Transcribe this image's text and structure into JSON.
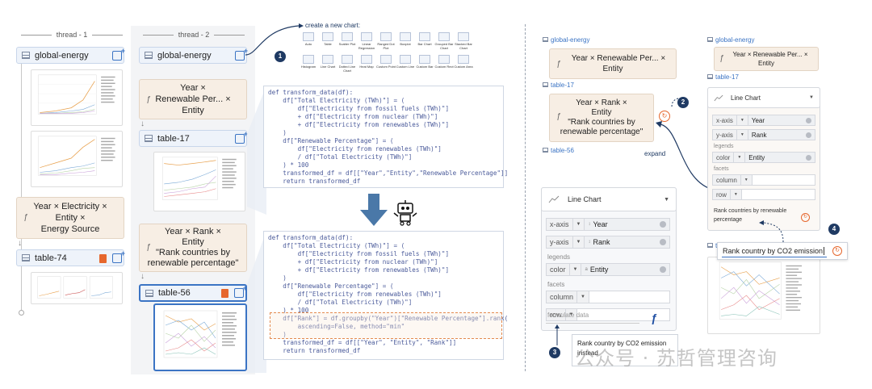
{
  "threads": {
    "thread1_label": "thread - 1",
    "thread2_label": "thread - 2"
  },
  "t1": {
    "global_energy": "global-energy",
    "formula_line1": "Year × Electricity ×",
    "formula_line2": "Entity ×",
    "formula_line3": "Energy Source",
    "table74": "table-74"
  },
  "t2": {
    "global_energy": "global-energy",
    "formula_a1": "Year ×",
    "formula_a2": "Renewable Per... ×",
    "formula_a3": "Entity",
    "table17": "table-17",
    "formula_b1": "Year × Rank ×",
    "formula_b2": "Entity",
    "formula_b3": "\"Rank countries by",
    "formula_b4": "renewable percentage\"",
    "table56": "table-56"
  },
  "new_chart": {
    "title": "create a new chart:",
    "types": [
      "Auto",
      "Table",
      "Scatter Plot",
      "Linear Regression",
      "Ranged Dot Plot",
      "Boxplot",
      "Bar Chart",
      "Grouped Bar Chart",
      "Stacked Bar Chart",
      "Histogram",
      "Line Chart",
      "Dotted Line Chart",
      "Heat Map",
      "Custom Point",
      "Custom Line",
      "Custom Bar",
      "Custom Rect",
      "Custom Area"
    ]
  },
  "code1": [
    "def transform_data(df):",
    "    df[\"Total Electricity (TWh)\"] = (",
    "        df[\"Electricity from fossil fuels (TWh)\"]",
    "        + df[\"Electricity from nuclear (TWh)\"]",
    "        + df[\"Electricity from renewables (TWh)\"]",
    "    )",
    "    df[\"Renewable Percentage\"] = (",
    "        df[\"Electricity from renewables (TWh)\"]",
    "        / df[\"Total Electricity (TWh)\"]",
    "    ) * 100",
    "    transformed_df = df[[\"Year\",\"Entity\",\"Renewable Percentage\"]]",
    "    return transformed_df"
  ],
  "code2": [
    "def transform_data(df):",
    "    df[\"Total Electricity (TWh)\"] = (",
    "        df[\"Electricity from fossil fuels (TWh)\"]",
    "        + df[\"Electricity from nuclear (TWh)\"]",
    "        + df[\"Electricity from renewables (TWh)\"]",
    "    )",
    "    df[\"Renewable Percentage\"] = (",
    "        df[\"Electricity from renewables (TWh)\"]",
    "        / df[\"Total Electricity (TWh)\"]",
    "    ) * 100",
    "    df[\"Rank\"] = df.groupby(\"Year\")[\"Renewable Percentage\"].rank(",
    "        ascending=False, method=\"min\"",
    "    )",
    "    transformed_df = df[[\"Year\", \"Entity\", \"Rank\"]]",
    "    return transformed_df"
  ],
  "mid": {
    "global_energy": "global-energy",
    "formula_a1": "Year × Renewable Per... ×",
    "formula_a2": "Entity",
    "table17": "table-17",
    "formula_b1": "Year × Rank ×",
    "formula_b2": "Entity",
    "formula_b3": "\"Rank countries by",
    "formula_b4": "renewable percentage\"",
    "expand": "expand",
    "table56": "table-56"
  },
  "enc_big": {
    "chart_type": "Line Chart",
    "xaxis_key": "x-axis",
    "xaxis_val": "Year",
    "yaxis_key": "y-axis",
    "yaxis_val": "Rank",
    "legends": "legends",
    "color_key": "color",
    "color_val": "Entity",
    "facets": "facets",
    "column_key": "column",
    "row_key": "row",
    "formulate_placeholder": "formulate data",
    "typed_line1": "Rank country by CO2 emission",
    "typed_line2": "instead"
  },
  "right": {
    "global_energy": "global-energy",
    "formula1": "Year × Renewable Per... ×",
    "formula2": "Entity",
    "table17": "table-17",
    "chart_type": "Line Chart",
    "xaxis_key": "x-axis",
    "xaxis_val": "Year",
    "yaxis_key": "y-axis",
    "yaxis_val": "Rank",
    "legends": "legends",
    "color_key": "color",
    "color_val": "Entity",
    "facets": "facets",
    "column_key": "column",
    "row_key": "row",
    "prompt_line1": "Rank countries by renewable",
    "prompt_line2": "percentage",
    "table_partial": "ta",
    "new_prompt": "Rank country by CO2 emission"
  },
  "badges": [
    "1",
    "2",
    "3",
    "4"
  ],
  "watermark": "公众号 · 苏哲管理咨询",
  "colors": {
    "accent": "#3b74c4",
    "badge": "#1f3a63",
    "orange": "#e6672d",
    "tan": "#f7eee4",
    "blue_card": "#eef3fa"
  }
}
